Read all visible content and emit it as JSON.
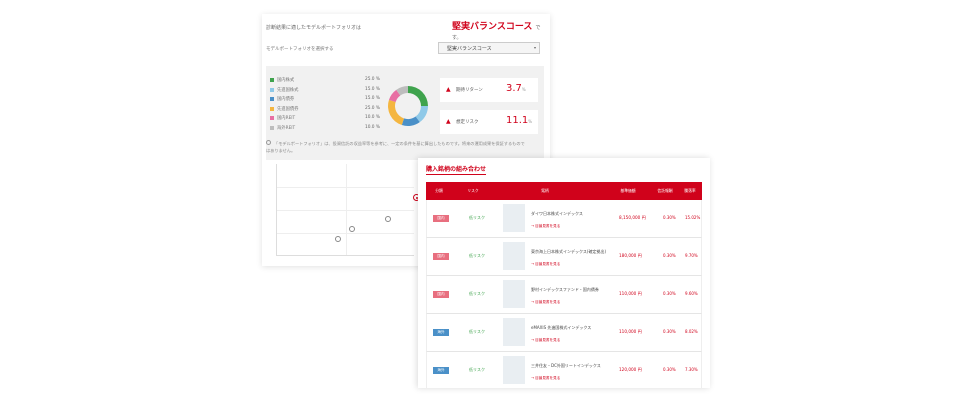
{
  "panel": {
    "question": "診断結果に適したモデルポートフォリオは",
    "result": "堅実バランスコース",
    "result_suffix": "です。",
    "select_label": "モデルポートフォリオを選択する",
    "select_value": "堅実バランスコース",
    "note": "「モデルポートフォリオ」は、投資信託の収益率等を参考に、一定の条件を基に算出したものです。将来の運用成果を保証するものではありません。",
    "stats": [
      {
        "label": "期待リターン",
        "value": "3.7",
        "unit": "%",
        "icon": "chart-up-icon"
      },
      {
        "label": "想定リスク",
        "value": "11.1",
        "unit": "%",
        "icon": "triangle-icon"
      }
    ]
  },
  "allocation": [
    {
      "name": "国内株式",
      "percent": "25.0 %",
      "color": "#3fa34d",
      "value": 25.0
    },
    {
      "name": "先進国株式",
      "percent": "15.0 %",
      "color": "#8fc9e8",
      "value": 15.0
    },
    {
      "name": "国内債券",
      "percent": "15.0 %",
      "color": "#4a90c8",
      "value": 15.0
    },
    {
      "name": "先進国債券",
      "percent": "25.0 %",
      "color": "#f4b640",
      "value": 25.0
    },
    {
      "name": "国内REIT",
      "percent": "10.0 %",
      "color": "#e86fa3",
      "value": 10.0
    },
    {
      "name": "海外REIT",
      "percent": "10.0 %",
      "color": "#bdbdbd",
      "value": 10.0
    }
  ],
  "funds": {
    "title": "購入銘柄の組み合わせ",
    "headers": [
      "分類",
      "リスク",
      "銘柄",
      "基準価額",
      "信託報酬",
      "騰落率"
    ],
    "rows": [
      {
        "badge": "国内",
        "badge_color": "#e86f7f",
        "risk": "低リスク",
        "name": "ダイワ日本株式インデックス",
        "link": "→ 目論見書を見る",
        "price": "8,150,000 円",
        "fee": "0.30%",
        "ret": "15.02%"
      },
      {
        "badge": "国内",
        "badge_color": "#e86f7f",
        "risk": "低リスク",
        "name": "東京海上日本株式インデックス(確定拠出)",
        "link": "→ 目論見書を見る",
        "price": "180,000 円",
        "fee": "0.30%",
        "ret": "9.70%"
      },
      {
        "badge": "国内",
        "badge_color": "#e86f7f",
        "risk": "低リスク",
        "name": "野村インデックスファンド・国内債券",
        "link": "→ 目論見書を見る",
        "price": "110,000 円",
        "fee": "0.30%",
        "ret": "9.60%"
      },
      {
        "badge": "海外",
        "badge_color": "#4a90c8",
        "risk": "低リスク",
        "name": "eMAXIS 先進国株式インデックス",
        "link": "→ 目論見書を見る",
        "price": "110,000 円",
        "fee": "0.30%",
        "ret": "8.02%"
      },
      {
        "badge": "海外",
        "badge_color": "#4a90c8",
        "risk": "低リスク",
        "name": "三井住友・DC外国リートインデックス",
        "link": "→ 目論見書を見る",
        "price": "120,000 円",
        "fee": "0.30%",
        "ret": "7.30%"
      }
    ]
  }
}
